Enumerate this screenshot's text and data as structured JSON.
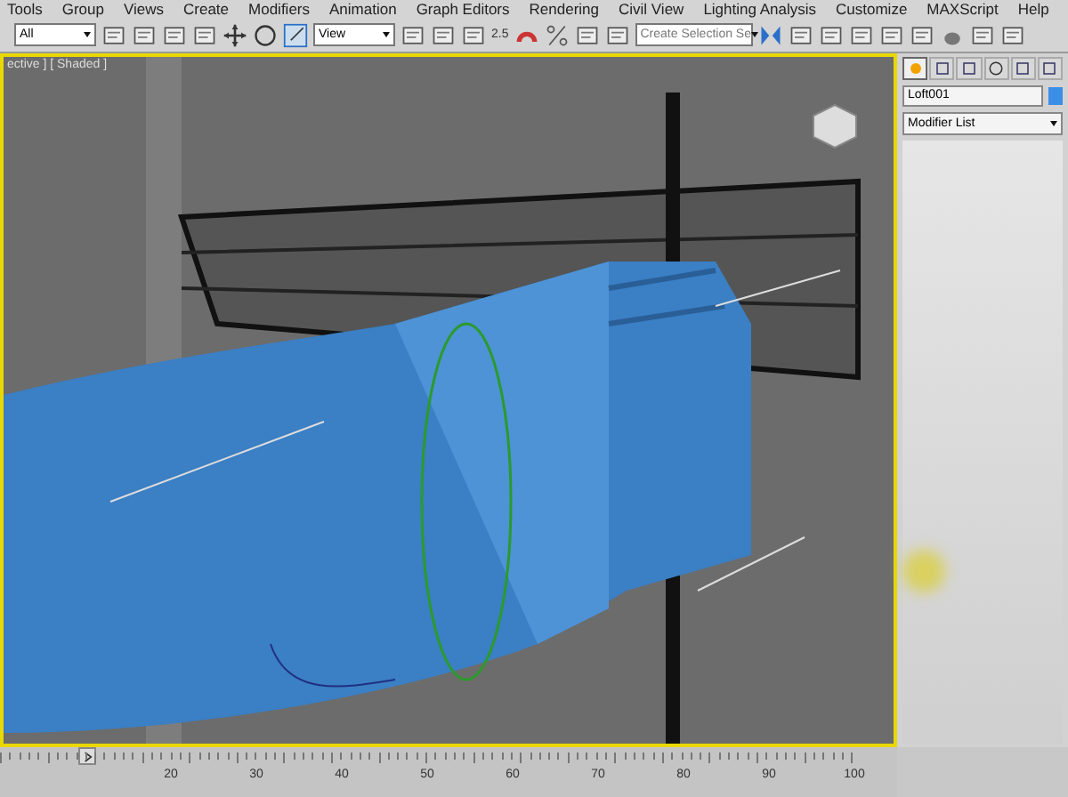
{
  "menu_bar": {
    "items": [
      "Tools",
      "Group",
      "Views",
      "Create",
      "Modifiers",
      "Animation",
      "Graph Editors",
      "Rendering",
      "Civil View",
      "Lighting Analysis",
      "Customize",
      "MAXScript",
      "Help"
    ]
  },
  "toolbar": {
    "items": [
      {
        "kind": "dropdown",
        "value": "All"
      },
      {
        "kind": "icon"
      },
      {
        "kind": "icon"
      },
      {
        "kind": "icon"
      },
      {
        "kind": "icon"
      },
      {
        "kind": "icon"
      },
      {
        "kind": "icon"
      },
      {
        "kind": "icon"
      },
      {
        "kind": "dropdown",
        "value": "View"
      },
      {
        "kind": "icon"
      },
      {
        "kind": "icon"
      },
      {
        "kind": "icon"
      },
      {
        "kind": "snap",
        "value": "2.5"
      },
      {
        "kind": "icon"
      },
      {
        "kind": "icon"
      },
      {
        "kind": "icon"
      },
      {
        "kind": "icon"
      },
      {
        "kind": "dropdown",
        "value": "Create Selection Se"
      },
      {
        "kind": "icon"
      },
      {
        "kind": "icon"
      },
      {
        "kind": "icon"
      },
      {
        "kind": "icon"
      },
      {
        "kind": "icon"
      },
      {
        "kind": "icon"
      },
      {
        "kind": "icon"
      },
      {
        "kind": "icon"
      },
      {
        "kind": "icon"
      }
    ]
  },
  "viewport": {
    "label": "ective ] [ Shaded ]"
  },
  "command_panel": {
    "tabs": [
      {
        "selected": true
      },
      {
        "selected": false
      },
      {
        "selected": false
      },
      {
        "selected": false
      },
      {
        "selected": false
      },
      {
        "selected": false
      }
    ],
    "object_name": "Loft001",
    "modifier_list": "Modifier List"
  },
  "timeline": {
    "labels": [
      "20",
      "30",
      "40",
      "50",
      "60",
      "70",
      "80",
      "90",
      "100"
    ]
  }
}
